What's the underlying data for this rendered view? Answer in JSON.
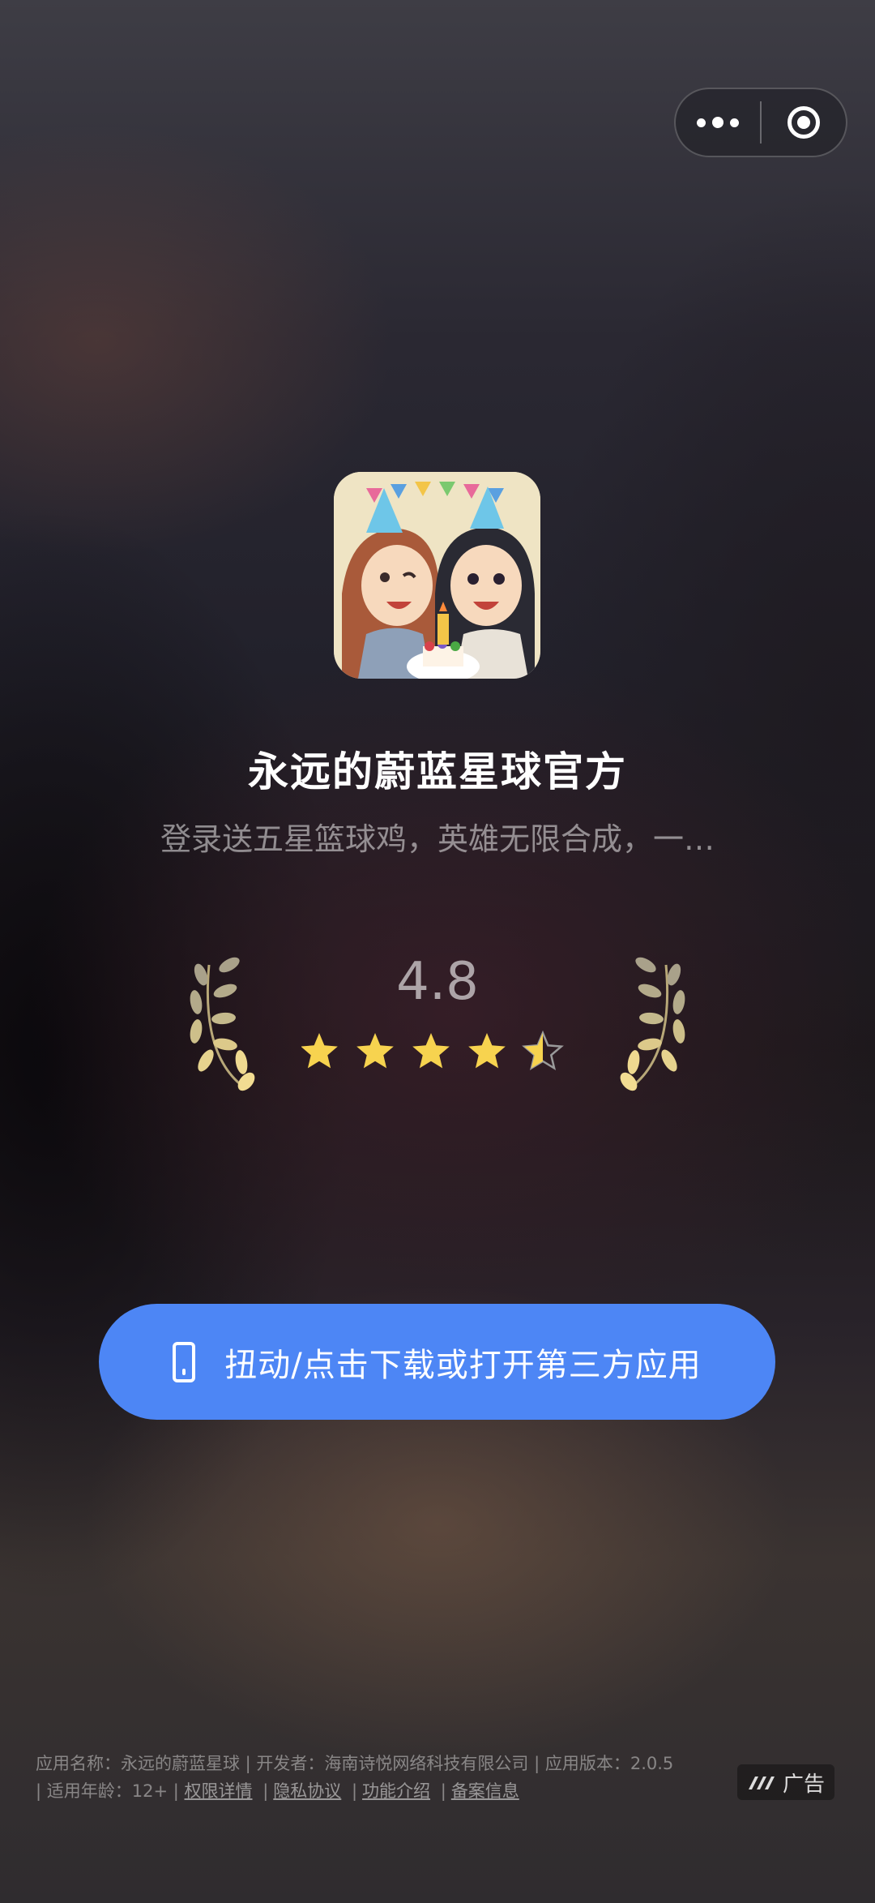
{
  "capsule": {
    "more_icon": "more-dots-icon",
    "close_icon": "target-circle-icon"
  },
  "app": {
    "title": "永远的蔚蓝星球官方",
    "subtitle": "登录送五星篮球鸡，英雄无限合成，一…"
  },
  "rating": {
    "value": "4.8",
    "stars": 4.5,
    "max_stars": 5,
    "star_color": "#f7d34f"
  },
  "cta": {
    "label": "扭动/点击下载或打开第三方应用",
    "color": "#4d86f5",
    "icon": "phone-icon"
  },
  "footer": {
    "line1": "应用名称：永远的蔚蓝星球 | 开发者：海南诗悦网络科技有限公司 | 应用版本：2.0.5",
    "age": "| 适用年龄：12+ |",
    "permissions": "权限详情",
    "privacy": "隐私协议",
    "features": "功能介绍",
    "filing": "备案信息",
    "sep": "|"
  },
  "ad": {
    "label": "广告"
  }
}
